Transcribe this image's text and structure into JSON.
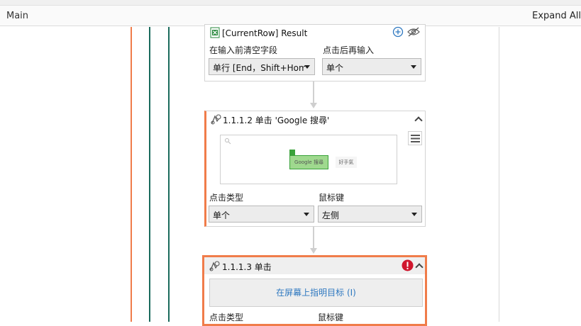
{
  "header": {
    "title": "Main",
    "expand_label": "Expand All"
  },
  "colors": {
    "orange": "#f07c4a",
    "teal": "#1a6b5c",
    "accent": "#2e78c0",
    "error": "#d0162d"
  },
  "card1": {
    "title": "[CurrentRow] Result",
    "field1_label": "在输入前清空字段",
    "field1_value": "单行 [End，Shift+Hom",
    "field2_label": "点击后再输入",
    "field2_value": "单个"
  },
  "card2": {
    "title": "1.1.1.2  单击 'Google 搜尋'",
    "preview_button_text": "Google 搜尋",
    "preview_other_text": "好手氣",
    "field1_label": "点击类型",
    "field1_value": "单个",
    "field2_label": "鼠标键",
    "field2_value": "左侧"
  },
  "card3": {
    "title": "1.1.1.3  单击",
    "target_button": "在屏幕上指明目标 (I)",
    "field1_label": "点击类型",
    "field2_label": "鼠标键"
  }
}
